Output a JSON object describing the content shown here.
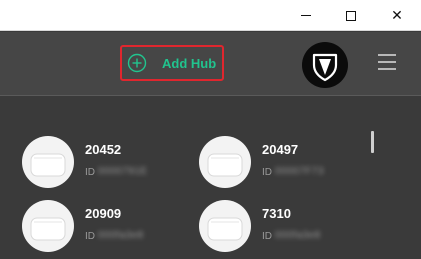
{
  "window": {
    "minimize_icon": "minimize-icon",
    "maximize_icon": "maximize-icon",
    "close_icon": "close-icon",
    "close_glyph": "✕"
  },
  "header": {
    "add_hub_label": "Add Hub",
    "add_hub_icon": "plus-circle-icon",
    "accent_color": "#21c48e",
    "highlight_color": "#e0262e",
    "logo_icon": "shield-logo-icon",
    "menu_icon": "hamburger-menu-icon"
  },
  "hubs": [
    {
      "name": "20452",
      "id_label": "ID",
      "id_value": "0000791E"
    },
    {
      "name": "20497",
      "id_label": "ID",
      "id_value": "00007F73"
    },
    {
      "name": "20909",
      "id_label": "ID",
      "id_value": "000fa3e8"
    },
    {
      "name": "7310",
      "id_label": "ID",
      "id_value": "000fa3e8"
    }
  ]
}
